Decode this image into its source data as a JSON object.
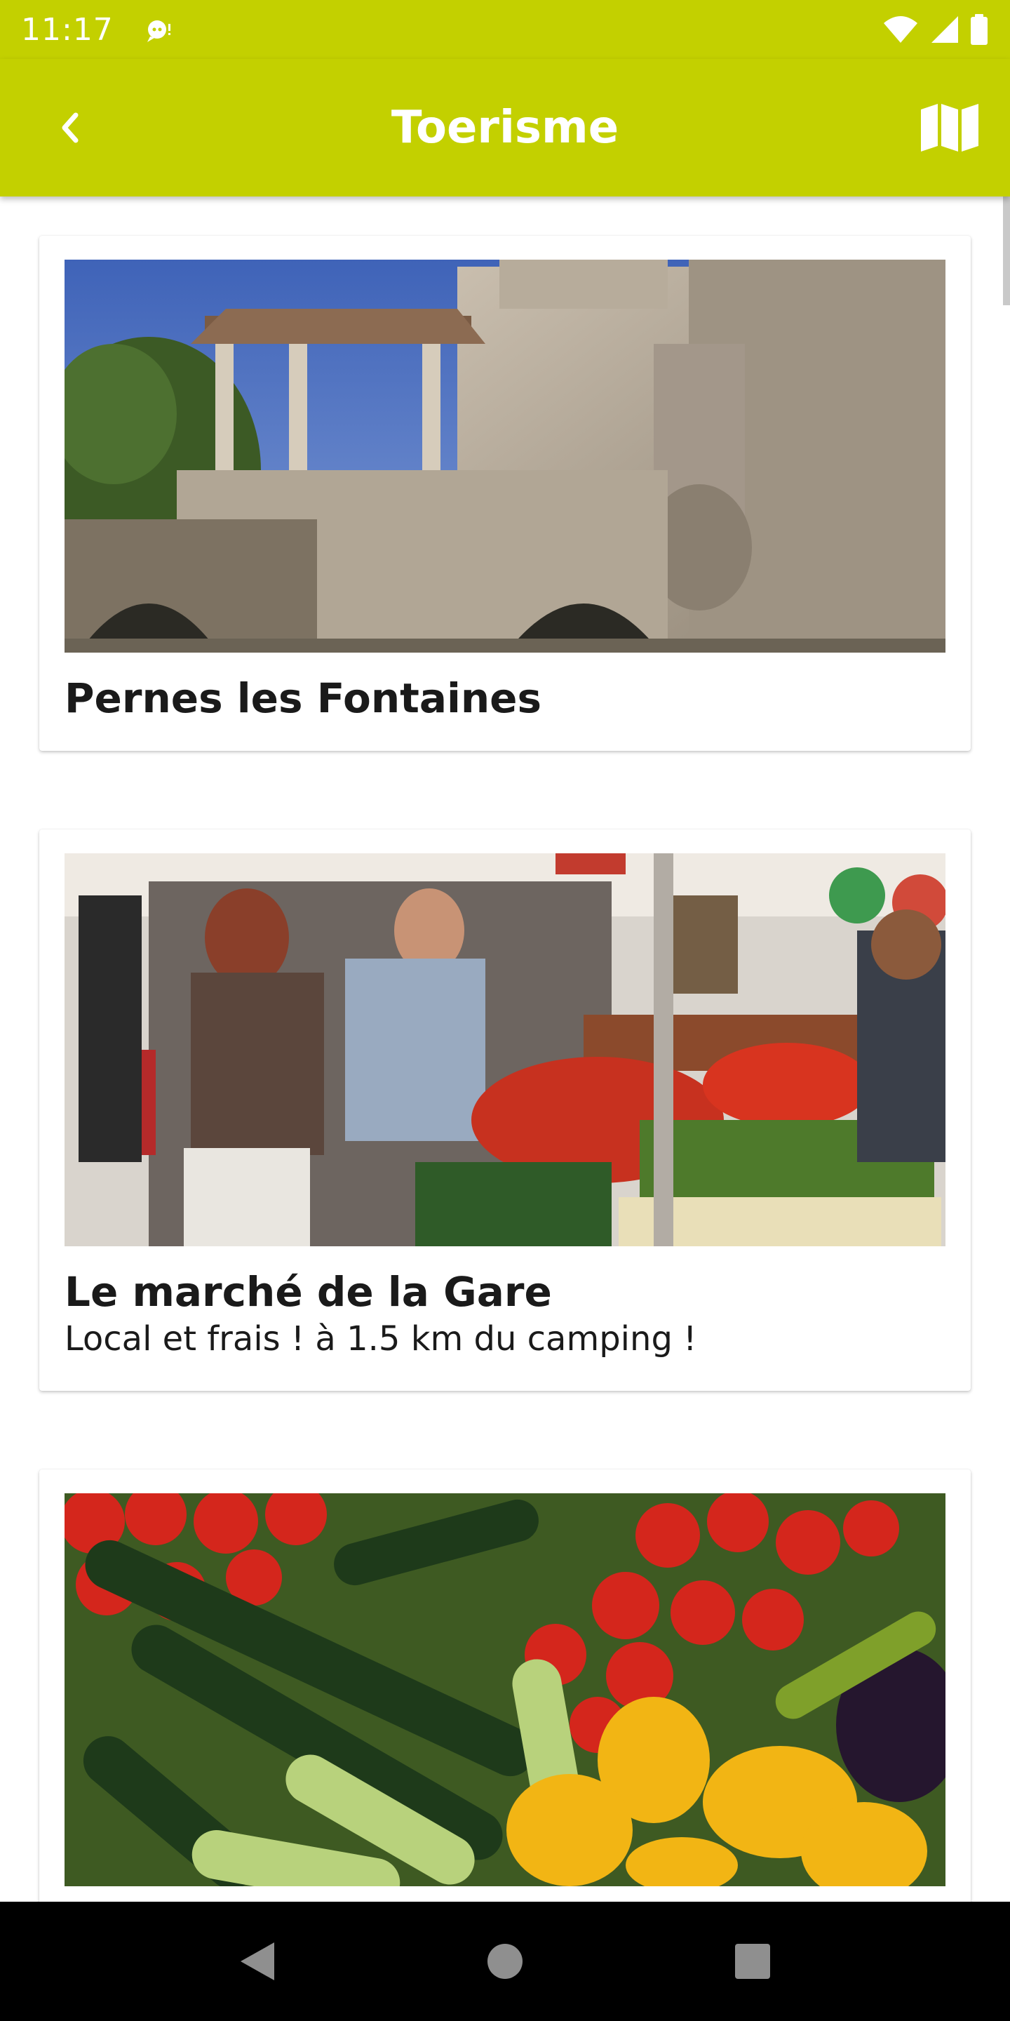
{
  "status_bar": {
    "time": "11:17"
  },
  "app_bar": {
    "title": "Toerisme",
    "back_icon": "chevron-left-icon",
    "map_icon": "map-icon"
  },
  "cards": [
    {
      "title": "Pernes les Fontaines",
      "subtitle": "",
      "image": "castle-gate-photo"
    },
    {
      "title": "Le marché de la Gare",
      "subtitle": "Local et frais ! à 1.5 km du camping !",
      "image": "market-photo"
    },
    {
      "title": "",
      "subtitle": "",
      "image": "vegetables-photo"
    }
  ],
  "colors": {
    "accent": "#c3d000",
    "text": "#1a1a1a",
    "nav_bar": "#000000"
  }
}
